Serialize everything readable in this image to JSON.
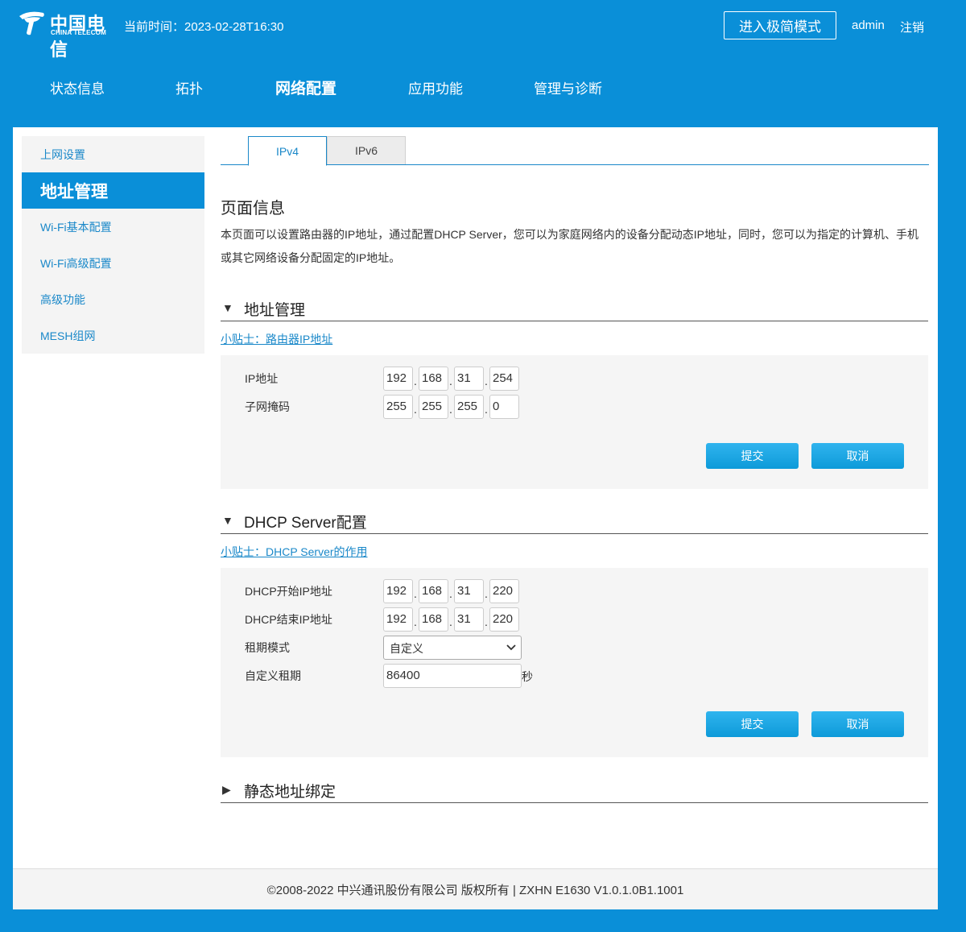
{
  "header": {
    "logo_cn": "中国电信",
    "logo_en": "CHINA TELECOM",
    "time_label": "当前时间：",
    "time_value": "2023-02-28T16:30",
    "simple_mode_label": "进入极简模式",
    "username": "admin",
    "logout_label": "注销"
  },
  "nav": {
    "items": [
      "状态信息",
      "拓扑",
      "网络配置",
      "应用功能",
      "管理与诊断"
    ],
    "active": "网络配置"
  },
  "sidebar": {
    "items": [
      "上网设置",
      "地址管理",
      "Wi-Fi基本配置",
      "Wi-Fi高级配置",
      "高级功能",
      "MESH组网"
    ],
    "active": "地址管理"
  },
  "tabs": [
    "IPv4",
    "IPv6"
  ],
  "page": {
    "title": "页面信息",
    "description": "本页面可以设置路由器的IP地址，通过配置DHCP Server，您可以为家庭网络内的设备分配动态IP地址，同时，您可以为指定的计算机、手机或其它网络设备分配固定的IP地址。"
  },
  "address_section": {
    "heading": "地址管理",
    "tip": "小贴士：路由器IP地址",
    "ip_label": "IP地址",
    "ip": [
      "192",
      "168",
      "31",
      "254"
    ],
    "mask_label": "子网掩码",
    "mask": [
      "255",
      "255",
      "255",
      "0"
    ],
    "submit_label": "提交",
    "cancel_label": "取消"
  },
  "dhcp_section": {
    "heading": "DHCP Server配置",
    "tip": "小贴士：DHCP Server的作用",
    "start_label": "DHCP开始IP地址",
    "start_ip": [
      "192",
      "168",
      "31",
      "220"
    ],
    "end_label": "DHCP结束IP地址",
    "end_ip": [
      "192",
      "168",
      "31",
      "220"
    ],
    "lease_mode_label": "租期模式",
    "lease_mode_value": "自定义",
    "custom_lease_label": "自定义租期",
    "custom_lease_value": "86400",
    "custom_lease_unit": "秒",
    "submit_label": "提交",
    "cancel_label": "取消"
  },
  "static_section": {
    "heading": "静态地址绑定"
  },
  "footer": {
    "text": "©2008-2022 中兴通讯股份有限公司 版权所有 |   ZXHN E1630 V1.0.1.0B1.1001"
  },
  "colors": {
    "brand_blue": "#0a8fd8",
    "link_blue": "#1a88c9",
    "button_blue": "#1ba6e6"
  }
}
